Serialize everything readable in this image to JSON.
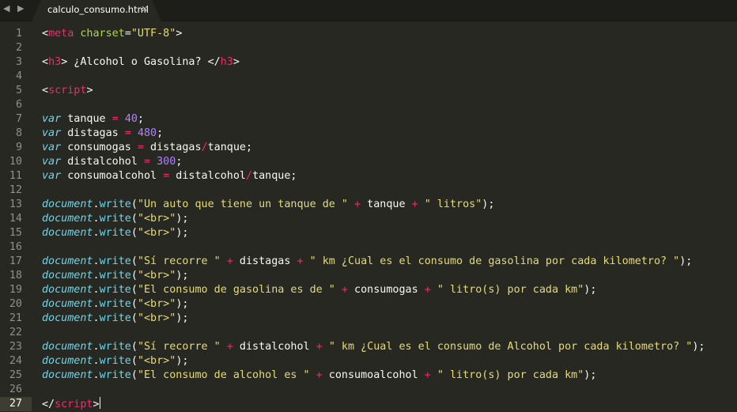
{
  "window": {
    "nav_arrows": "◀ ▶",
    "tab": {
      "label": "calculo_consumo.html",
      "close_glyph": "×"
    }
  },
  "colors": {
    "background": "#272822",
    "text": "#f8f8f2",
    "tag": "#f92672",
    "attribute": "#a6e22e",
    "string": "#e6db74",
    "keyword_italic": "#66d9ef",
    "number": "#ae81ff",
    "operator": "#f92672",
    "gutter_number": "#90908a"
  },
  "editor": {
    "current_line": 27,
    "lines": [
      {
        "n": "1",
        "tokens": [
          [
            "p",
            "<"
          ],
          [
            "t",
            "meta"
          ],
          [
            "p",
            " "
          ],
          [
            "a",
            "charset"
          ],
          [
            "p",
            "="
          ],
          [
            "s",
            "\"UTF-8\""
          ],
          [
            "p",
            ">"
          ]
        ]
      },
      {
        "n": "2",
        "tokens": []
      },
      {
        "n": "3",
        "tokens": [
          [
            "p",
            "<"
          ],
          [
            "t",
            "h3"
          ],
          [
            "p",
            "> ¿Alcohol o Gasolina? </"
          ],
          [
            "t",
            "h3"
          ],
          [
            "p",
            ">"
          ]
        ]
      },
      {
        "n": "4",
        "tokens": []
      },
      {
        "n": "5",
        "tokens": [
          [
            "p",
            "<"
          ],
          [
            "t",
            "script"
          ],
          [
            "p",
            ">"
          ]
        ]
      },
      {
        "n": "6",
        "tokens": []
      },
      {
        "n": "7",
        "tokens": [
          [
            "k",
            "var"
          ],
          [
            "p",
            " tanque "
          ],
          [
            "o",
            "="
          ],
          [
            "p",
            " "
          ],
          [
            "num",
            "40"
          ],
          [
            "p",
            ";"
          ]
        ]
      },
      {
        "n": "8",
        "tokens": [
          [
            "k",
            "var"
          ],
          [
            "p",
            " distagas "
          ],
          [
            "o",
            "="
          ],
          [
            "p",
            " "
          ],
          [
            "num",
            "480"
          ],
          [
            "p",
            ";"
          ]
        ]
      },
      {
        "n": "9",
        "tokens": [
          [
            "k",
            "var"
          ],
          [
            "p",
            " consumogas "
          ],
          [
            "o",
            "="
          ],
          [
            "p",
            " distagas"
          ],
          [
            "o",
            "/"
          ],
          [
            "p",
            "tanque;"
          ]
        ]
      },
      {
        "n": "10",
        "tokens": [
          [
            "k",
            "var"
          ],
          [
            "p",
            " distalcohol "
          ],
          [
            "o",
            "="
          ],
          [
            "p",
            " "
          ],
          [
            "num",
            "300"
          ],
          [
            "p",
            ";"
          ]
        ]
      },
      {
        "n": "11",
        "tokens": [
          [
            "k",
            "var"
          ],
          [
            "p",
            " consumoalcohol "
          ],
          [
            "o",
            "="
          ],
          [
            "p",
            " distalcohol"
          ],
          [
            "o",
            "/"
          ],
          [
            "p",
            "tanque;"
          ]
        ]
      },
      {
        "n": "12",
        "tokens": []
      },
      {
        "n": "13",
        "tokens": [
          [
            "k",
            "document"
          ],
          [
            "p",
            "."
          ],
          [
            "f",
            "write"
          ],
          [
            "p",
            "("
          ],
          [
            "s",
            "\"Un auto que tiene un tanque de \""
          ],
          [
            "p",
            " "
          ],
          [
            "o",
            "+"
          ],
          [
            "p",
            " tanque "
          ],
          [
            "o",
            "+"
          ],
          [
            "p",
            " "
          ],
          [
            "s",
            "\" litros\""
          ],
          [
            "p",
            ");"
          ]
        ]
      },
      {
        "n": "14",
        "tokens": [
          [
            "k",
            "document"
          ],
          [
            "p",
            "."
          ],
          [
            "f",
            "write"
          ],
          [
            "p",
            "("
          ],
          [
            "s",
            "\"<br>\""
          ],
          [
            "p",
            ");"
          ]
        ]
      },
      {
        "n": "15",
        "tokens": [
          [
            "k",
            "document"
          ],
          [
            "p",
            "."
          ],
          [
            "f",
            "write"
          ],
          [
            "p",
            "("
          ],
          [
            "s",
            "\"<br>\""
          ],
          [
            "p",
            ");"
          ]
        ]
      },
      {
        "n": "16",
        "tokens": []
      },
      {
        "n": "17",
        "tokens": [
          [
            "k",
            "document"
          ],
          [
            "p",
            "."
          ],
          [
            "f",
            "write"
          ],
          [
            "p",
            "("
          ],
          [
            "s",
            "\"Sí recorre \""
          ],
          [
            "p",
            " "
          ],
          [
            "o",
            "+"
          ],
          [
            "p",
            " distagas "
          ],
          [
            "o",
            "+"
          ],
          [
            "p",
            " "
          ],
          [
            "s",
            "\" km ¿Cual es el consumo de gasolina por cada kilometro? \""
          ],
          [
            "p",
            ");"
          ]
        ]
      },
      {
        "n": "18",
        "tokens": [
          [
            "k",
            "document"
          ],
          [
            "p",
            "."
          ],
          [
            "f",
            "write"
          ],
          [
            "p",
            "("
          ],
          [
            "s",
            "\"<br>\""
          ],
          [
            "p",
            ");"
          ]
        ]
      },
      {
        "n": "19",
        "tokens": [
          [
            "k",
            "document"
          ],
          [
            "p",
            "."
          ],
          [
            "f",
            "write"
          ],
          [
            "p",
            "("
          ],
          [
            "s",
            "\"El consumo de gasolina es de \""
          ],
          [
            "p",
            " "
          ],
          [
            "o",
            "+"
          ],
          [
            "p",
            " consumogas "
          ],
          [
            "o",
            "+"
          ],
          [
            "p",
            " "
          ],
          [
            "s",
            "\" litro(s) por cada km\""
          ],
          [
            "p",
            ");"
          ]
        ]
      },
      {
        "n": "20",
        "tokens": [
          [
            "k",
            "document"
          ],
          [
            "p",
            "."
          ],
          [
            "f",
            "write"
          ],
          [
            "p",
            "("
          ],
          [
            "s",
            "\"<br>\""
          ],
          [
            "p",
            ");"
          ]
        ]
      },
      {
        "n": "21",
        "tokens": [
          [
            "k",
            "document"
          ],
          [
            "p",
            "."
          ],
          [
            "f",
            "write"
          ],
          [
            "p",
            "("
          ],
          [
            "s",
            "\"<br>\""
          ],
          [
            "p",
            ");"
          ]
        ]
      },
      {
        "n": "22",
        "tokens": []
      },
      {
        "n": "23",
        "tokens": [
          [
            "k",
            "document"
          ],
          [
            "p",
            "."
          ],
          [
            "f",
            "write"
          ],
          [
            "p",
            "("
          ],
          [
            "s",
            "\"Sí recorre \""
          ],
          [
            "p",
            " "
          ],
          [
            "o",
            "+"
          ],
          [
            "p",
            " distalcohol "
          ],
          [
            "o",
            "+"
          ],
          [
            "p",
            " "
          ],
          [
            "s",
            "\" km ¿Cual es el consumo de Alcohol por cada kilometro? \""
          ],
          [
            "p",
            ");"
          ]
        ]
      },
      {
        "n": "24",
        "tokens": [
          [
            "k",
            "document"
          ],
          [
            "p",
            "."
          ],
          [
            "f",
            "write"
          ],
          [
            "p",
            "("
          ],
          [
            "s",
            "\"<br>\""
          ],
          [
            "p",
            ");"
          ]
        ]
      },
      {
        "n": "25",
        "tokens": [
          [
            "k",
            "document"
          ],
          [
            "p",
            "."
          ],
          [
            "f",
            "write"
          ],
          [
            "p",
            "("
          ],
          [
            "s",
            "\"El consumo de alcohol es \""
          ],
          [
            "p",
            " "
          ],
          [
            "o",
            "+"
          ],
          [
            "p",
            " consumoalcohol "
          ],
          [
            "o",
            "+"
          ],
          [
            "p",
            " "
          ],
          [
            "s",
            "\" litro(s) por cada km\""
          ],
          [
            "p",
            ");"
          ]
        ]
      },
      {
        "n": "26",
        "tokens": []
      },
      {
        "n": "27",
        "tokens": [
          [
            "p",
            "</"
          ],
          [
            "t",
            "script"
          ],
          [
            "p",
            ">"
          ]
        ]
      }
    ]
  }
}
